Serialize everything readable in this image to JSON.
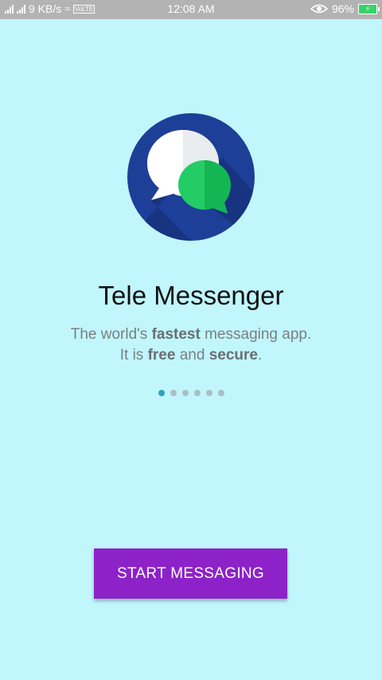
{
  "status_bar": {
    "speed": "9 KB/s",
    "volte": "VoLTE",
    "time": "12:08 AM",
    "battery": "96%"
  },
  "app": {
    "title": "Tele Messenger",
    "line1": {
      "before": "The world's ",
      "bold": "fastest",
      "after": " messaging app."
    },
    "line2": {
      "before": "It is ",
      "bold1": "free",
      "middle": " and ",
      "bold2": "secure",
      "after": "."
    }
  },
  "pager": {
    "count": 6,
    "active_index": 0
  },
  "start_button": {
    "label": "START MESSAGING"
  },
  "colors": {
    "background": "#c1f6fd",
    "logo_circle": "#1e3f97",
    "bubble_green": "#20c35a",
    "button": "#8d22c9",
    "active_dot": "#2fa1bf"
  }
}
